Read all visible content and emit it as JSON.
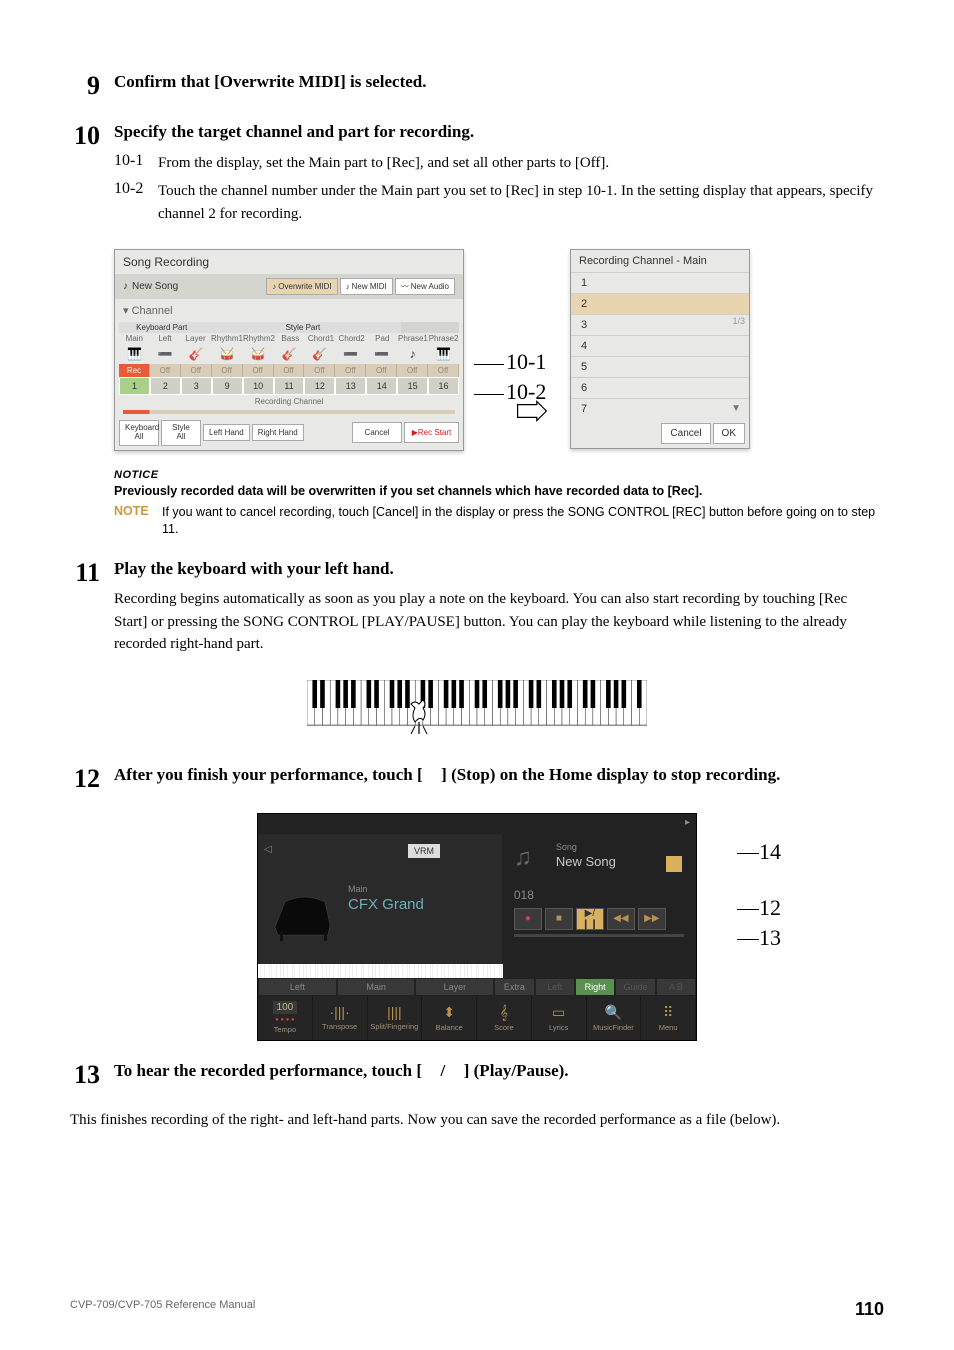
{
  "steps": {
    "s9": {
      "num": "9",
      "title": "Confirm that [Overwrite MIDI] is selected."
    },
    "s10": {
      "num": "10",
      "title": "Specify the target channel and part for recording.",
      "sub1_num": "10-1",
      "sub1_text": "From the display, set the Main part to [Rec], and set all other parts to [Off].",
      "sub2_num": "10-2",
      "sub2_text_a": "Touch the channel number under the Main part you set to [Rec] in step 10-1. In the setting display that appears, specify channel 2 for recording."
    },
    "s11": {
      "num": "11",
      "title": "Play the keyboard with your left hand.",
      "body": "Recording begins automatically as soon as you play a note on the keyboard. You can also start recording by touching [Rec Start] or pressing the SONG CONTROL [PLAY/PAUSE] button. You can play the keyboard while listening to the already recorded right-hand part."
    },
    "s12": {
      "num": "12",
      "title_a": "After you finish your performance, touch [",
      "title_b": "] (Stop) on the Home display to stop recording."
    },
    "s13": {
      "num": "13",
      "title_a": "To hear the recorded performance, touch [",
      "title_b": "/",
      "title_c": "] (Play/Pause)."
    },
    "final": "This finishes recording of the right- and left-hand parts. Now you can save the recorded performance as a file (below)."
  },
  "notice": {
    "label": "NOTICE",
    "text": "Previously recorded data will be overwritten if you set channels which have recorded data to [Rec].",
    "note_label": "NOTE",
    "note_text": "If you want to cancel recording, touch [Cancel] in the display or press the SONG CONTROL [REC] button before going on to step 11."
  },
  "panel1": {
    "title": "Song Recording",
    "newsong": "New Song",
    "tab_overwrite": "Overwrite MIDI",
    "tab_newmidi": "New MIDI",
    "tab_newaudio": "New Audio",
    "channel": "Channel",
    "kbdpart": "Keyboard Part",
    "stylepart": "Style Part",
    "parts": [
      "Main",
      "Left",
      "Layer",
      "Rhythm1",
      "Rhythm2",
      "Bass",
      "Chord1",
      "Chord2",
      "Pad",
      "Phrase1",
      "Phrase2"
    ],
    "icons": [
      "🎹",
      "➖",
      "🎸",
      "🥁",
      "🥁",
      "🎸",
      "🎸",
      "➖",
      "➖",
      "♪",
      "🎹"
    ],
    "rec": "Rec",
    "off": "Off",
    "nums": [
      "1",
      "2",
      "3",
      "9",
      "10",
      "11",
      "12",
      "13",
      "14",
      "15",
      "16"
    ],
    "recch": "Recording Channel",
    "kbd_all": "Keyboard All",
    "style_all": "Style All",
    "left_hand": "Left Hand",
    "right_hand": "Right Hand",
    "cancel": "Cancel",
    "rec_start": "▶Rec Start"
  },
  "callouts": {
    "c101": "10-1",
    "c102": "10-2",
    "c14": "14",
    "c12": "12",
    "c13": "13"
  },
  "panel2": {
    "title": "Recording Channel - Main",
    "items": [
      "1",
      "2",
      "3",
      "4",
      "5",
      "6",
      "7"
    ],
    "scroll": "1/3",
    "cancel": "Cancel",
    "ok": "OK"
  },
  "home": {
    "vrm": "VRM",
    "main": "Main",
    "cfx": "CFX Grand",
    "song": "Song",
    "newsong": "New Song",
    "counter": "018",
    "tabs_left": [
      "Left",
      "Main",
      "Layer"
    ],
    "tabs_right": [
      "Extra",
      "Left",
      "Right",
      "Guide",
      "A B"
    ],
    "bottom": [
      {
        "icon": "100",
        "label": "Tempo"
      },
      {
        "icon": "·|||·",
        "label": "Transpose"
      },
      {
        "icon": "||||",
        "label": "Split/Fingering"
      },
      {
        "icon": "⬍",
        "label": "Balance"
      },
      {
        "icon": "𝄞",
        "label": "Score"
      },
      {
        "icon": "▭",
        "label": "Lyrics"
      },
      {
        "icon": "🔍",
        "label": "MusicFinder"
      },
      {
        "icon": "⠿",
        "label": "Menu"
      }
    ]
  },
  "footer": {
    "left": "CVP-709/CVP-705 Reference Manual",
    "page": "110"
  }
}
